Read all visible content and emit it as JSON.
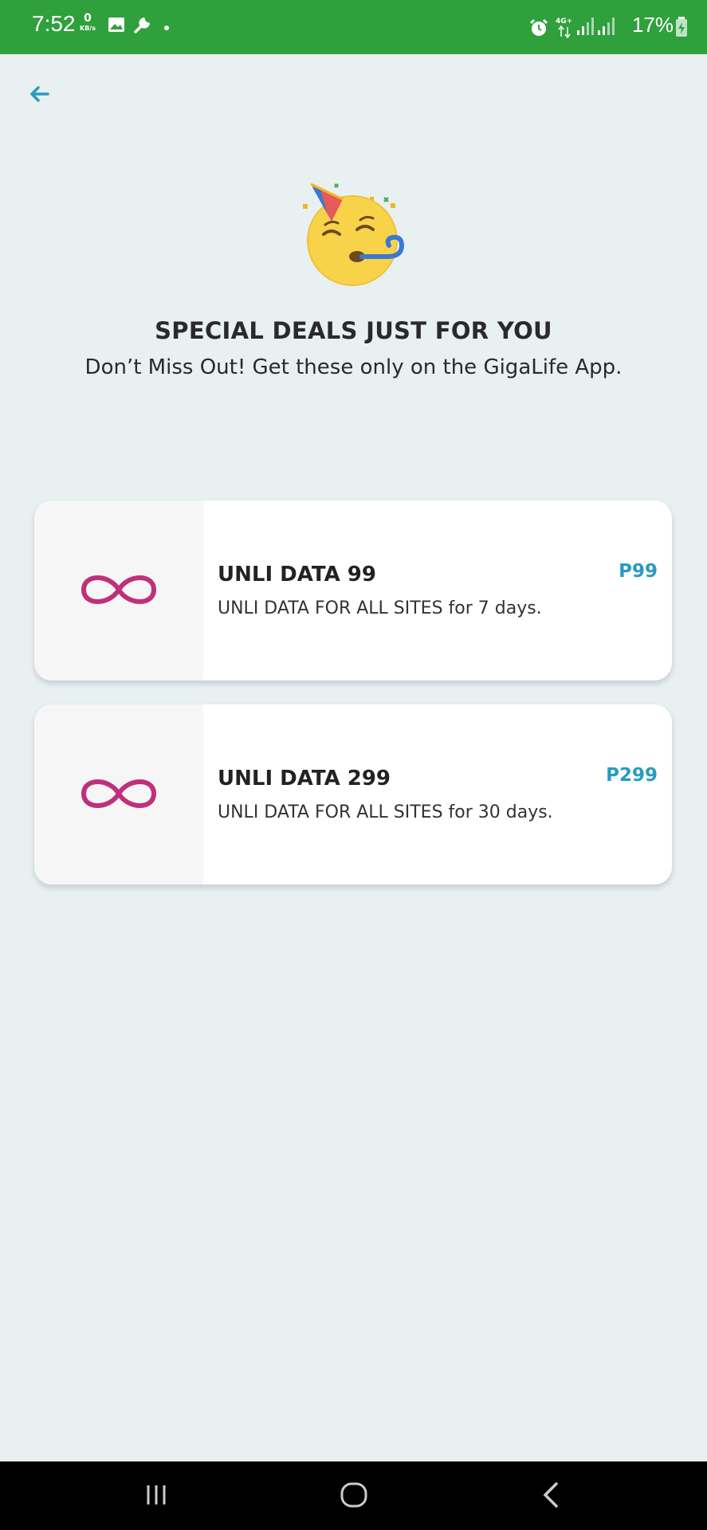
{
  "status_bar": {
    "time": "7:52",
    "data_rate_value": "0",
    "data_rate_unit": "KB/s",
    "battery": "17%",
    "icons": [
      "image-icon",
      "wrench-icon",
      "dot-icon",
      "alarm-icon",
      "4g-icon",
      "signal-icon",
      "signal-icon",
      "battery-charging-icon"
    ]
  },
  "header": {
    "back_icon": "arrow-left-icon"
  },
  "hero": {
    "emoji": "partying-face-icon",
    "title": "SPECIAL DEALS JUST FOR YOU",
    "subtitle": "Don’t Miss Out! Get these only on the GigaLife App."
  },
  "deals": [
    {
      "icon": "infinity-icon",
      "title": "UNLI DATA 99",
      "description": "UNLI DATA FOR ALL SITES for 7 days.",
      "price": "P99"
    },
    {
      "icon": "infinity-icon",
      "title": "UNLI DATA 299",
      "description": "UNLI DATA FOR ALL SITES for 30 days.",
      "price": "P299"
    }
  ],
  "colors": {
    "status_bar": "#2fa03c",
    "background": "#e8f0f2",
    "accent": "#2a9bc0",
    "infinity": "#c0307a"
  },
  "nav_bar": {
    "buttons": [
      "recent-apps-icon",
      "home-icon",
      "back-icon"
    ]
  }
}
